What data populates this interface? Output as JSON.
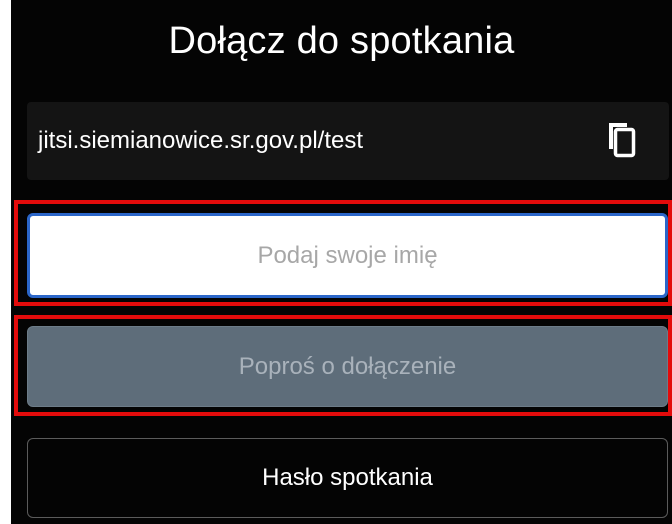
{
  "title": "Dołącz do spotkania",
  "meeting_url": "jitsi.siemianowice.sr.gov.pl/test",
  "copy_icon": "copy-icon",
  "name_input": {
    "placeholder": "Podaj swoje imię",
    "value": ""
  },
  "join_button_label": "Poproś o dołączenie",
  "password_button_label": "Hasło spotkania",
  "colors": {
    "background": "#040404",
    "highlight": "#e30b0b",
    "input_border": "#2b66c9",
    "join_button_bg": "#5e6d7a"
  }
}
